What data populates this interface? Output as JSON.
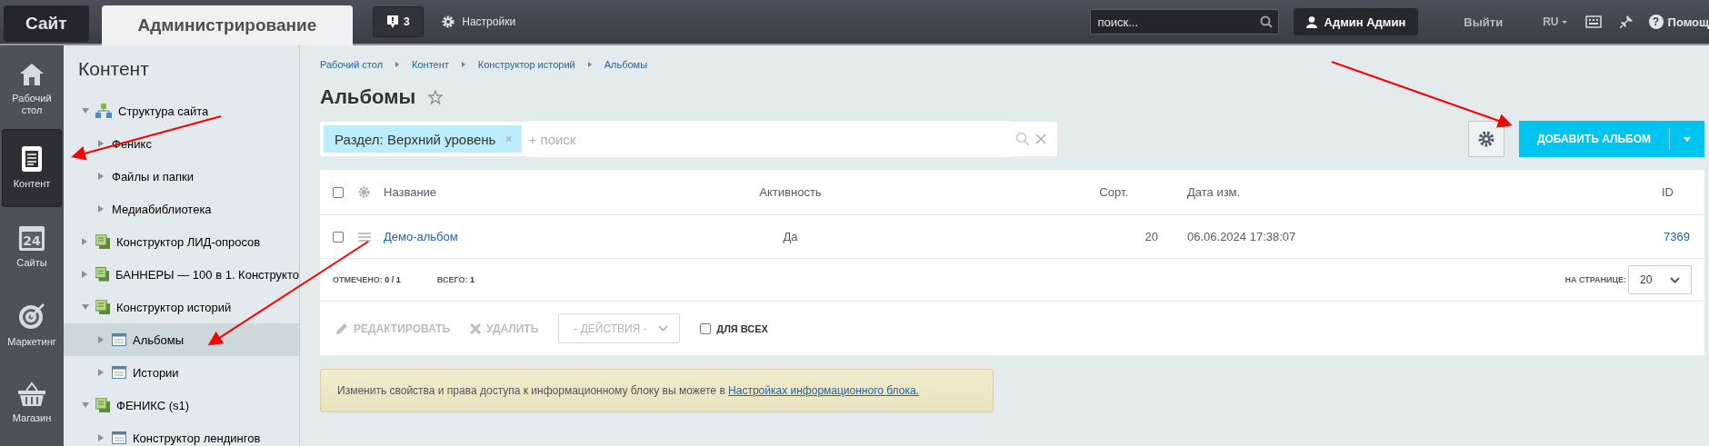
{
  "top_bar": {
    "tabs": [
      {
        "label": "Сайт",
        "selected": false
      },
      {
        "label": "Администрирование",
        "selected": true
      }
    ],
    "notifications": "3",
    "settings": "Настройки",
    "search": {
      "placeholder": "поиск..."
    },
    "user": "Админ Админ",
    "logout": "Выйти",
    "language": "RU",
    "help_icon": "?",
    "help": "Помощ"
  },
  "nav": [
    {
      "kind": "home",
      "label": "Рабочий стол",
      "selected": false
    },
    {
      "kind": "document",
      "label": "Контент",
      "selected": true
    },
    {
      "kind": "calendar",
      "day": "24",
      "label": "Сайты",
      "selected": false
    },
    {
      "kind": "target",
      "label": "Маркетинг",
      "selected": false
    },
    {
      "kind": "basket",
      "label": "Магазин",
      "selected": false
    }
  ],
  "tree": {
    "title": "Контент",
    "items": [
      {
        "kind": "structure",
        "label": "Структура сайта",
        "expanded": true,
        "selected": false,
        "children": [
          {
            "kind": "none",
            "label": "Феникс",
            "expanded": false,
            "selected": false
          },
          {
            "kind": "none",
            "label": "Файлы и папки",
            "expanded": false,
            "selected": false
          },
          {
            "kind": "none",
            "label": "Медиабиблиотека",
            "expanded": false,
            "selected": false
          }
        ]
      },
      {
        "kind": "block",
        "label": "Конструктор ЛИД-опросов",
        "expanded": false,
        "selected": false
      },
      {
        "kind": "block",
        "label": "БАННЕРЫ — 100 в 1. Конструкто",
        "expanded": false,
        "selected": false
      },
      {
        "kind": "block",
        "label": "Конструктор историй",
        "expanded": true,
        "selected": false,
        "children": [
          {
            "kind": "list",
            "label": "Альбомы",
            "expanded": false,
            "selected": true
          },
          {
            "kind": "list",
            "label": "Истории",
            "expanded": false,
            "selected": false
          }
        ]
      },
      {
        "kind": "block",
        "label": "ФЕНИКС (s1)",
        "expanded": true,
        "selected": false,
        "children": [
          {
            "kind": "list",
            "label": "Конструктор лендингов",
            "expanded": false,
            "selected": false
          }
        ]
      }
    ]
  },
  "breadcrumb": [
    "Рабочий стол",
    "Контент",
    "Конструктор историй",
    "Альбомы"
  ],
  "title": "Альбомы",
  "filter": {
    "tag": "Раздел: Верхний уровень",
    "tag_remove": "×",
    "placeholder": "+ поиск"
  },
  "add_button": "ДОБАВИТЬ АЛЬБОМ",
  "table": {
    "columns": [
      "Название",
      "Активность",
      "Сорт.",
      "Дата изм.",
      "ID"
    ],
    "header_checked": false,
    "rows": [
      {
        "checked": false,
        "name": "Демо-альбом",
        "active": "Да",
        "sort": "20",
        "date": "06.06.2024 17:38:07",
        "id": "7369"
      }
    ]
  },
  "footer": {
    "selected_label": "ОТМЕЧЕНО:",
    "selected_value": "0 / 1",
    "total_label": "ВСЕГО:",
    "total_value": "1",
    "per_page_label": "НА СТРАНИЦЕ:",
    "per_page": "20"
  },
  "actions": {
    "edit": {
      "label": "РЕДАКТИРОВАТЬ",
      "disabled": true
    },
    "delete": {
      "label": "УДАЛИТЬ",
      "disabled": true
    },
    "select": "- ДЕЙСТВИЯ -",
    "for_all": {
      "label": "ДЛЯ ВСЕХ",
      "checked": false
    }
  },
  "info": {
    "text": "Изменить свойства и права доступа к информационному блоку вы можете в ",
    "link": "Настройках информационного блока."
  }
}
